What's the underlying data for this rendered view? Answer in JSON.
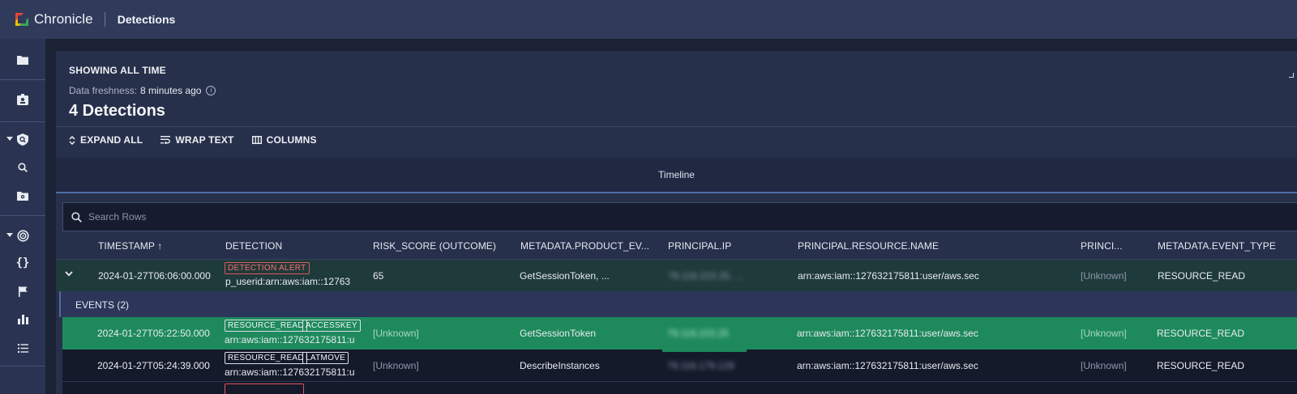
{
  "topbar": {
    "brand": "Chronicle",
    "page_title": "Detections"
  },
  "sidebar": {
    "items": [
      {
        "icon": "folder-icon"
      },
      {
        "icon": "id-badge-icon"
      },
      {
        "icon": "shield-detection-icon",
        "expandable": true
      },
      {
        "icon": "search-icon"
      },
      {
        "icon": "folder-eye-icon"
      },
      {
        "icon": "target-icon",
        "expandable": true
      },
      {
        "icon": "curly-braces-icon"
      },
      {
        "icon": "flag-icon"
      },
      {
        "icon": "bar-chart-icon"
      },
      {
        "icon": "list-icon"
      }
    ]
  },
  "panel": {
    "showing": "SHOWING ALL TIME",
    "freshness_label": "Data freshness:",
    "freshness_value": "8 minutes ago",
    "count": "4 Detections",
    "toolbar": {
      "expand_all": "EXPAND ALL",
      "wrap_text": "WRAP TEXT",
      "columns": "COLUMNS"
    },
    "timeline_label": "Timeline",
    "search_placeholder": "Search Rows"
  },
  "table": {
    "columns": [
      "TIMESTAMP ↑",
      "DETECTION",
      "RISK_SCORE (OUTCOME)",
      "METADATA.PRODUCT_EV...",
      "PRINCIPAL.IP",
      "PRINCIPAL.RESOURCE.NAME",
      "PRINCI...",
      "METADATA.EVENT_TYPE"
    ],
    "detection_row": {
      "timestamp": "2024-01-27T06:06:00.000",
      "badge": "DETECTION ALERT",
      "detection": "p_userid:arn:aws:iam::12763",
      "risk_score": "65",
      "product_event": "GetSessionToken, ...",
      "principal_ip": "79.116.223.25, ...",
      "resource_name": "arn:aws:iam::127632175811:user/aws.sec",
      "principal": "[Unknown]",
      "event_type": "RESOURCE_READ"
    },
    "events_label": "EVENTS (2)",
    "events": [
      {
        "timestamp": "2024-01-27T05:22:50.000",
        "tags": [
          "RESOURCE_READ",
          "ACCESSKEY"
        ],
        "detection": "arn:aws:iam::127632175811:u",
        "risk_score": "[Unknown]",
        "product_event": "GetSessionToken",
        "principal_ip": "79.116.223.25",
        "resource_name": "arn:aws:iam::127632175811:user/aws.sec",
        "principal": "[Unknown]",
        "event_type": "RESOURCE_READ"
      },
      {
        "timestamp": "2024-01-27T05:24:39.000",
        "tags": [
          "RESOURCE_READ",
          "LATMOVE"
        ],
        "detection": "arn:aws:iam::127632175811:u",
        "risk_score": "[Unknown]",
        "product_event": "DescribeInstances",
        "principal_ip": "79.116.179.129",
        "resource_name": "arn:aws:iam::127632175811:user/aws.sec",
        "principal": "[Unknown]",
        "event_type": "RESOURCE_READ"
      }
    ]
  },
  "colors": {
    "topbar": "#303b5c",
    "selected_row": "#1e8a5c",
    "alert": "#e0555f",
    "detection_row": "#1f3a3a"
  }
}
